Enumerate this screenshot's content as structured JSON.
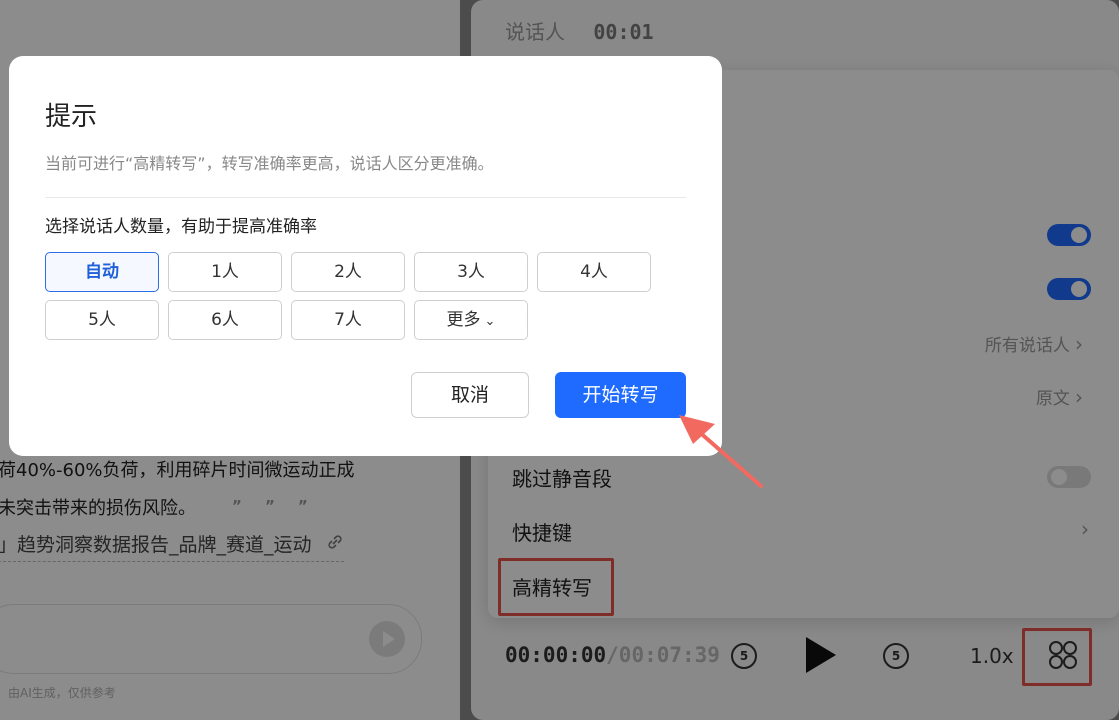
{
  "right_panel": {
    "speaker_label": "说话人",
    "speaker_time": "00:01",
    "settings": {
      "items": [
        {
          "label": "",
          "type": "toggle",
          "on": true
        },
        {
          "label": "",
          "type": "toggle",
          "on": true
        },
        {
          "label": "",
          "value": "所有说话人",
          "type": "link"
        },
        {
          "label": "",
          "value": "原文",
          "type": "link"
        },
        {
          "label": "跳过静音段",
          "type": "toggle",
          "on": false
        },
        {
          "label": "快捷键",
          "type": "link"
        },
        {
          "label": "高精转写",
          "type": "action"
        }
      ]
    },
    "player": {
      "current_time": "00:00:00",
      "total_time": "/00:07:39",
      "rewind_seconds": "5",
      "forward_seconds": "5",
      "speed": "1.0x"
    }
  },
  "left_panel": {
    "line1": "荷40%-60%负荷，利用碎片时间微运动正成",
    "line2": "未突击带来的损伤风险。",
    "quote_icons": [
      "”",
      "”",
      "”"
    ],
    "tag_line": "」趋势洞察数据报告_品牌_赛道_运动",
    "ai_note": "由AI生成，仅供参考"
  },
  "dialog": {
    "title": "提示",
    "description": "当前可进行“高精转写”，转写准确率更高，说话人区分更准确。",
    "subtitle": "选择说话人数量，有助于提高准确率",
    "options": [
      "自动",
      "1人",
      "2人",
      "3人",
      "4人",
      "5人",
      "6人",
      "7人",
      "更多"
    ],
    "selected_option": "自动",
    "more_chevron": "⌄",
    "cancel_label": "取消",
    "start_label": "开始转写"
  },
  "colors": {
    "accent": "#1f6bff",
    "highlight": "#e8534a"
  }
}
